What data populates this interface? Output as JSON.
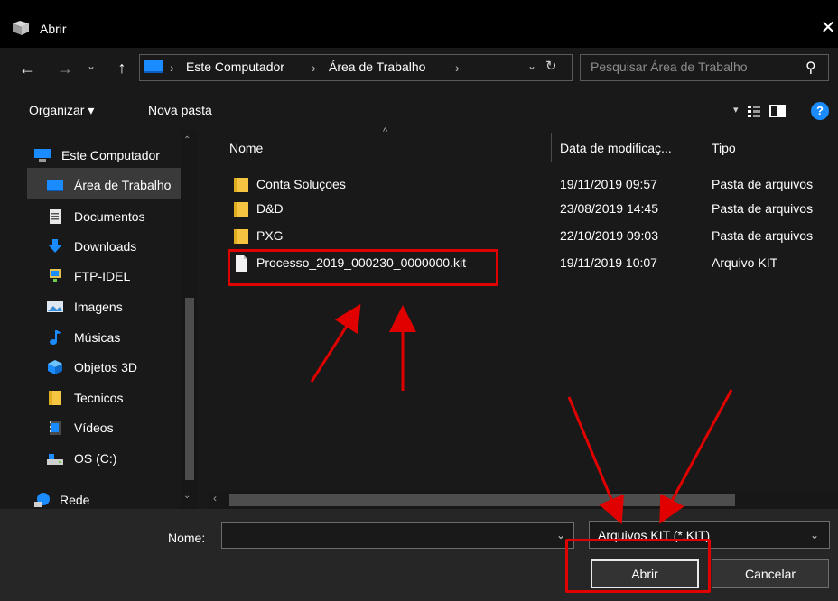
{
  "window": {
    "title": "Abrir",
    "close_glyph": "✕"
  },
  "nav": {
    "back_glyph": "←",
    "forward_glyph": "→",
    "recent_glyph": "⌄",
    "up_glyph": "↑",
    "breadcrumb": [
      "Este Computador",
      "Área de Trabalho"
    ],
    "sep_glyph": "›",
    "drop_glyph": "⌄",
    "refresh_glyph": "↻",
    "search_placeholder": "Pesquisar Área de Trabalho",
    "search_glyph": "⚲"
  },
  "toolbar": {
    "organize": "Organizar ▾",
    "new_folder": "Nova pasta",
    "view_drop": "▾",
    "help": "?"
  },
  "sidebar": {
    "scroll_up": "⌃",
    "scroll_down": "⌄",
    "items": [
      {
        "label": "Este Computador",
        "icon": "computer-icon"
      },
      {
        "label": "Área de Trabalho",
        "icon": "desktop-icon",
        "selected": true
      },
      {
        "label": "Documentos",
        "icon": "document-icon"
      },
      {
        "label": "Downloads",
        "icon": "download-icon"
      },
      {
        "label": "FTP-IDEL",
        "icon": "network-location-icon"
      },
      {
        "label": "Imagens",
        "icon": "pictures-icon"
      },
      {
        "label": "Músicas",
        "icon": "music-icon"
      },
      {
        "label": "Objetos 3D",
        "icon": "3d-objects-icon"
      },
      {
        "label": "Tecnicos",
        "icon": "folder-icon"
      },
      {
        "label": "Vídeos",
        "icon": "videos-icon"
      },
      {
        "label": "OS (C:)",
        "icon": "drive-icon"
      },
      {
        "label": "Rede",
        "icon": "network-icon"
      }
    ]
  },
  "columns": {
    "name": "Nome",
    "date": "Data de modificaç...",
    "type": "Tipo",
    "sort_glyph": "^"
  },
  "files": [
    {
      "name": "Conta Soluçoes",
      "date": "19/11/2019 09:57",
      "type": "Pasta de arquivos",
      "icon": "folder-icon"
    },
    {
      "name": "D&D",
      "date": "23/08/2019 14:45",
      "type": "Pasta de arquivos",
      "icon": "folder-icon"
    },
    {
      "name": "PXG",
      "date": "22/10/2019 09:03",
      "type": "Pasta de arquivos",
      "icon": "folder-icon"
    },
    {
      "name": "Processo_2019_000230_0000000.kit",
      "date": "19/11/2019 10:07",
      "type": "Arquivo KIT",
      "icon": "file-icon"
    }
  ],
  "hscroll_left": "‹",
  "bottom": {
    "name_label": "Nome:",
    "name_value": "",
    "name_drop": "⌄",
    "filter": "Arquivos KIT (*.KIT)",
    "filter_drop": "⌄",
    "open": "Abrir",
    "cancel": "Cancelar"
  },
  "colors": {
    "annotation": "#e00000",
    "accent": "#1a8cff",
    "folder": "#f5c542"
  }
}
